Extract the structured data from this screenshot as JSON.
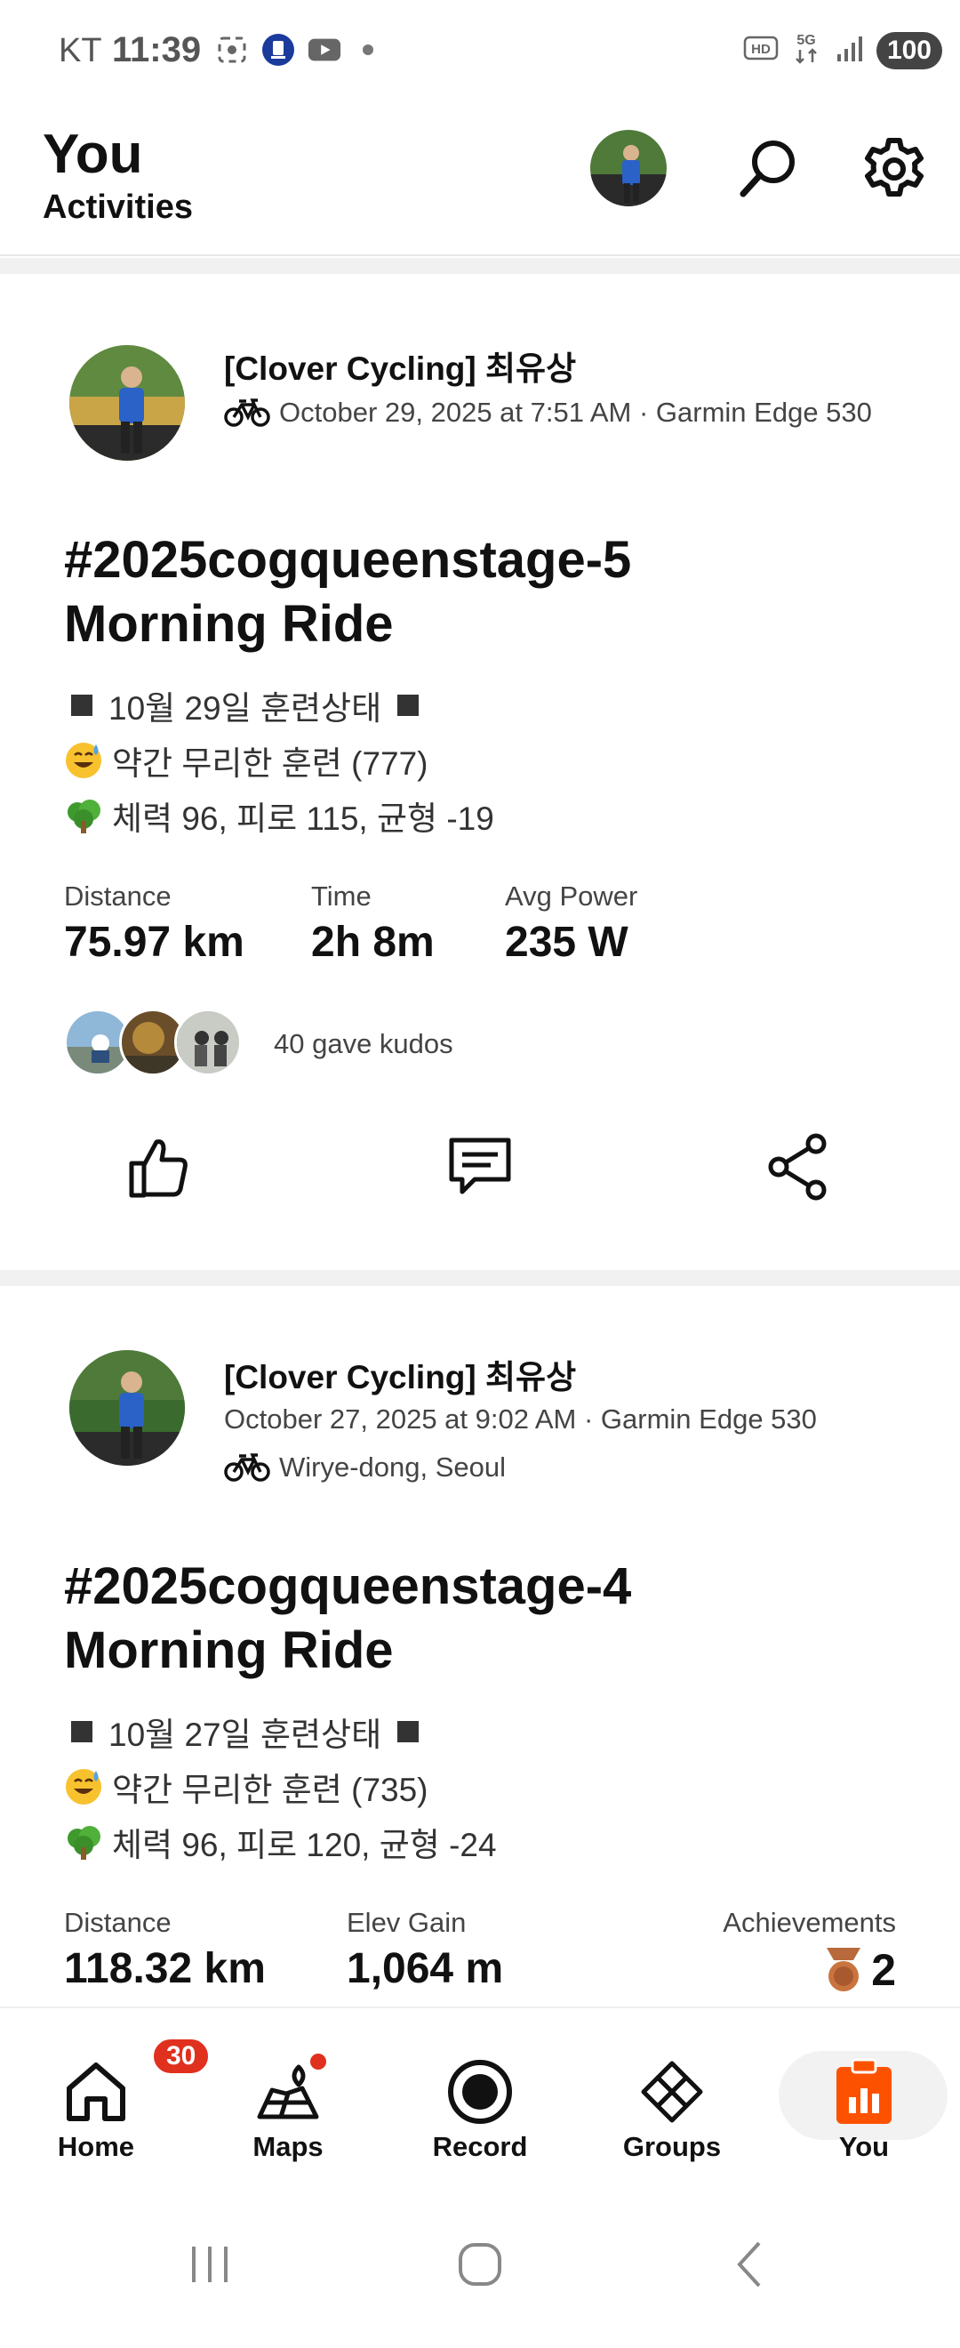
{
  "status_bar": {
    "carrier": "KT",
    "time": "11:39",
    "battery": "100"
  },
  "header": {
    "title": "You",
    "subtitle": "Activities"
  },
  "activities": [
    {
      "athlete": "[Clover Cycling] 최유상",
      "meta_line": "October 29, 2025 at 7:51 AM · Garmin Edge 530",
      "title_line1": "#2025cogqueenstage-5",
      "title_line2": "Morning Ride",
      "desc1": "10월 29일 훈련상태",
      "desc2": "약간 무리한 훈련 (777)",
      "desc3": "체력 96, 피로 115, 균형 -19",
      "stats": [
        {
          "label": "Distance",
          "value": "75.97 km"
        },
        {
          "label": "Time",
          "value": "2h 8m"
        },
        {
          "label": "Avg Power",
          "value": "235 W"
        }
      ],
      "kudos": "40 gave kudos"
    },
    {
      "athlete": "[Clover Cycling] 최유상",
      "meta_line": "October 27, 2025 at 9:02 AM · Garmin Edge 530",
      "location": "Wirye-dong, Seoul",
      "title_line1": "#2025cogqueenstage-4",
      "title_line2": "Morning Ride",
      "desc1": "10월 27일 훈련상태",
      "desc2": "약간 무리한 훈련 (735)",
      "desc3": "체력 96, 피로 120, 균형 -24",
      "stats": [
        {
          "label": "Distance",
          "value": "118.32 km"
        },
        {
          "label": "Elev Gain",
          "value": "1,064 m"
        }
      ],
      "achievements_label": "Achievements",
      "achievements_value": "2"
    }
  ],
  "nav": {
    "home": "Home",
    "home_badge": "30",
    "maps": "Maps",
    "record": "Record",
    "groups": "Groups",
    "you": "You"
  },
  "colors": {
    "accent": "#fc5200",
    "badge": "#e0301e"
  },
  "icons": [
    "search-icon",
    "settings-icon",
    "bike-icon",
    "thumbs-up-icon",
    "comment-icon",
    "share-icon",
    "medal-icon",
    "home-icon",
    "maps-icon",
    "record-icon",
    "groups-icon",
    "you-icon"
  ]
}
